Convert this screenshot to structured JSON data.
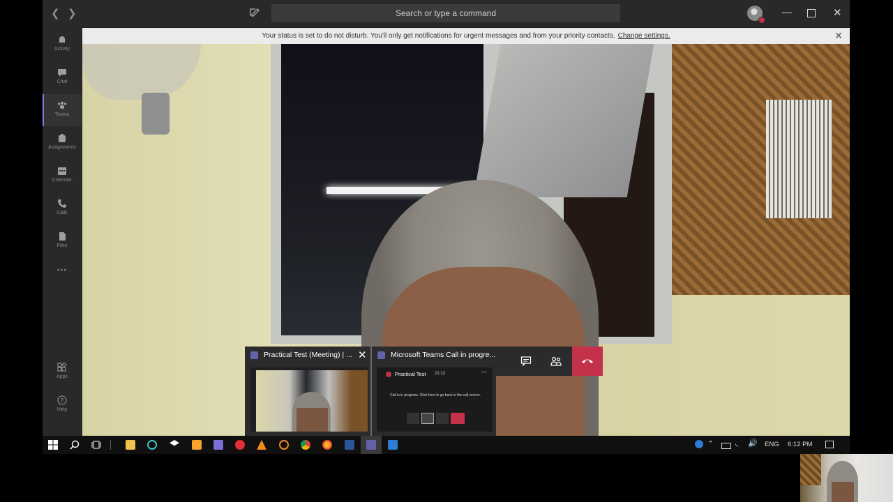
{
  "app": {
    "search_placeholder": "Search or type a command"
  },
  "rail": {
    "items": [
      {
        "label": "Activity",
        "icon": "bell-icon"
      },
      {
        "label": "Chat",
        "icon": "chat-icon"
      },
      {
        "label": "Teams",
        "icon": "teams-icon"
      },
      {
        "label": "Assignments",
        "icon": "assignments-icon"
      },
      {
        "label": "Calendar",
        "icon": "calendar-icon"
      },
      {
        "label": "Calls",
        "icon": "phone-icon"
      },
      {
        "label": "Files",
        "icon": "files-icon"
      },
      {
        "label": "Apps",
        "icon": "apps-icon"
      },
      {
        "label": "Help",
        "icon": "help-icon"
      }
    ],
    "more": "..."
  },
  "banner": {
    "text": "Your status is set to do not disturb. You'll only get notifications for urgent messages and from your priority contacts.",
    "link": "Change settings."
  },
  "previews": {
    "meeting_title": "Practical Test (Meeting) | ...",
    "call_title": "Microsoft Teams Call in progre...",
    "call_mini": {
      "name": "Practical Test",
      "time": "21:12",
      "message": "Call is in progress. Click here to go back to the call screen."
    }
  },
  "taskbar": {
    "language": "ENG",
    "time": "6:12 PM"
  },
  "colors": {
    "accent": "#6264a7",
    "hangup": "#c4314b",
    "rail_bg": "#292929"
  }
}
